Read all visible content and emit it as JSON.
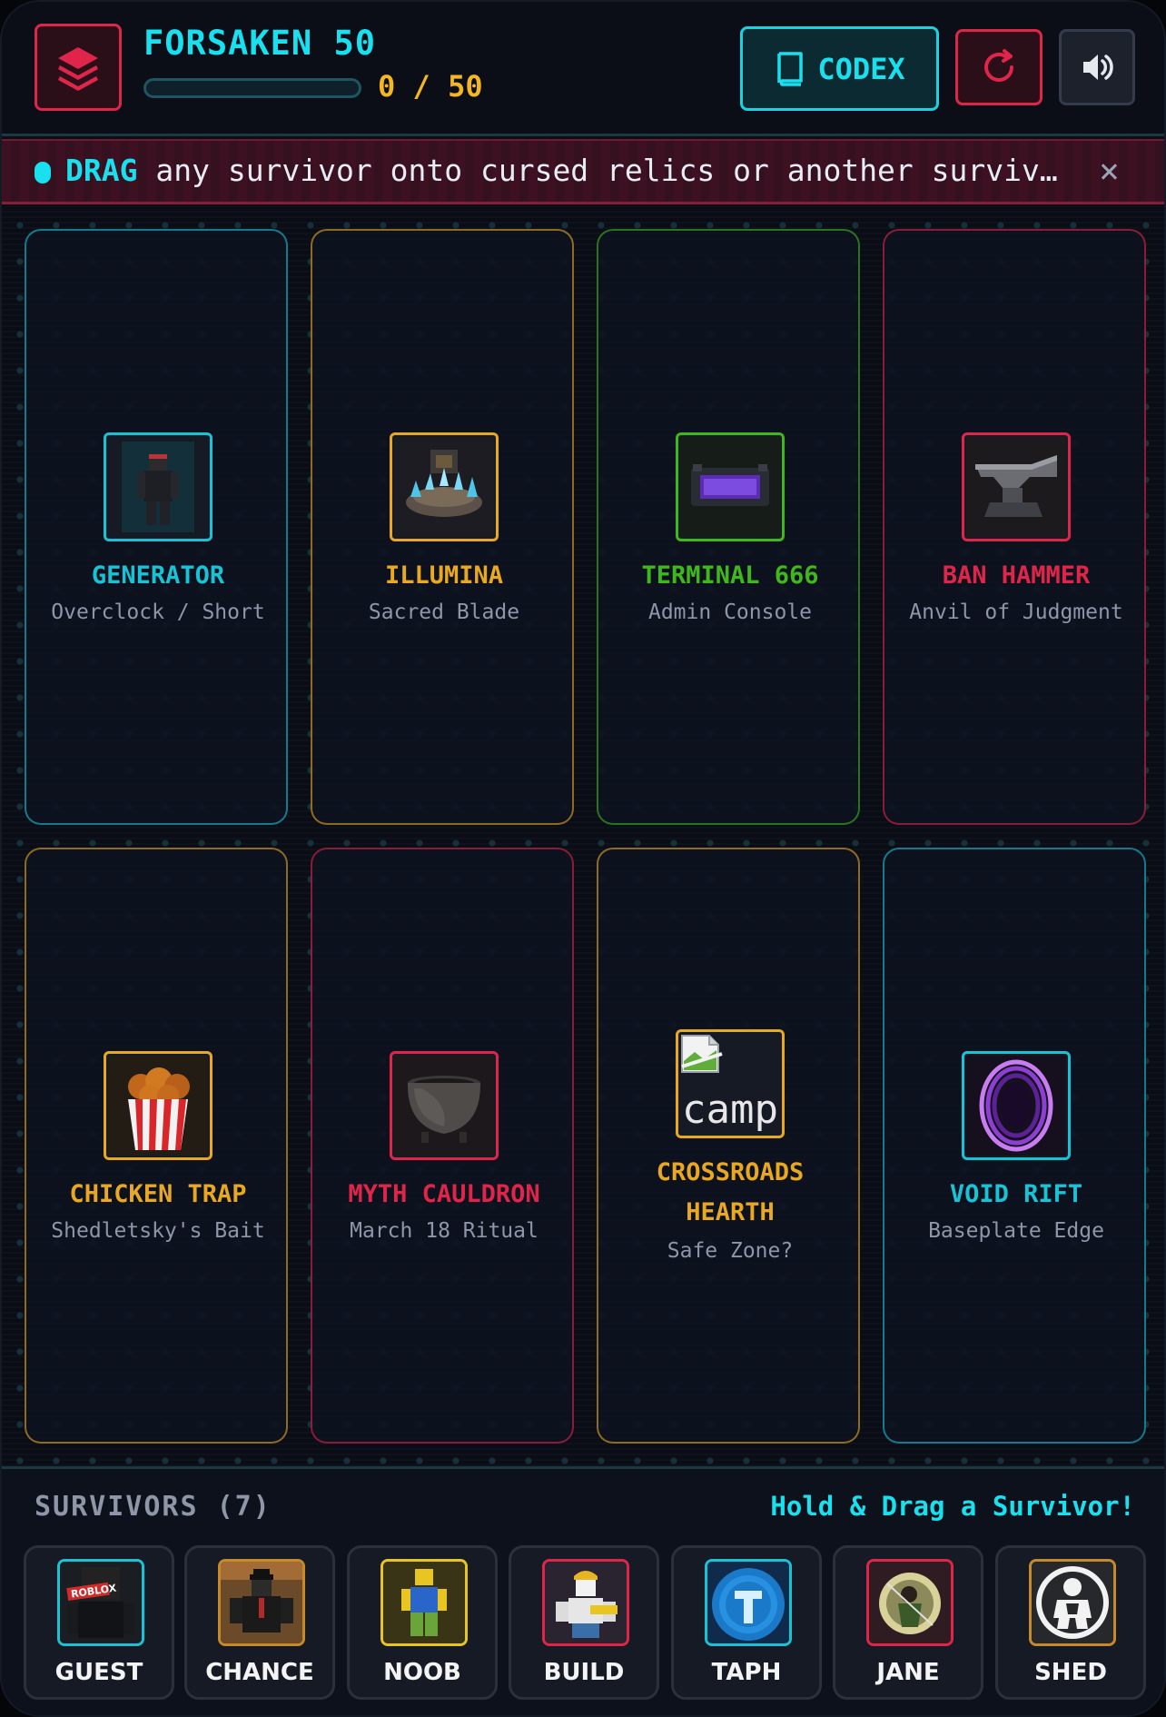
{
  "header": {
    "title": "FORSAKEN 50",
    "progress_text": "0 / 50",
    "progress_fraction": 0,
    "codex_label": "CODEX",
    "icons": {
      "logo": "layers-icon",
      "codex": "book-icon",
      "reset": "reset-icon",
      "sound": "speaker-icon"
    }
  },
  "banner": {
    "strong": "DRAG",
    "text": " any survivor onto cursed relics or another survivor to combine them!",
    "close": "×"
  },
  "relics": [
    {
      "name": "GENERATOR",
      "subtitle": "Overclock / Short",
      "color": "#19c3d6",
      "icon": "generator-figure-icon"
    },
    {
      "name": "ILLUMINA",
      "subtitle": "Sacred Blade",
      "color": "#e8a821",
      "icon": "crystal-altar-icon"
    },
    {
      "name": "TERMINAL 666",
      "subtitle": "Admin Console",
      "color": "#3fb81c",
      "icon": "terminal-icon"
    },
    {
      "name": "BAN HAMMER",
      "subtitle": "Anvil of Judgment",
      "color": "#e0254a",
      "icon": "anvil-icon"
    },
    {
      "name": "CHICKEN TRAP",
      "subtitle": "Shedletsky's Bait",
      "color": "#e8a821",
      "icon": "fried-chicken-bucket-icon"
    },
    {
      "name": "MYTH CAULDRON",
      "subtitle": "March 18 Ritual",
      "color": "#e0254a",
      "icon": "cauldron-icon"
    },
    {
      "name": "CROSSROADS\nHEARTH",
      "name_line1": "CROSSROADS",
      "name_line2": "HEARTH",
      "subtitle": "Safe Zone?",
      "color": "#e8a821",
      "icon": "broken-image-icon",
      "icon_alt": "camp"
    },
    {
      "name": "VOID RIFT",
      "subtitle": "Baseplate Edge",
      "color": "#19c3d6",
      "icon": "purple-portal-icon"
    }
  ],
  "survivors": {
    "title": "SURVIVORS (7)",
    "hint": "Hold & Drag a Survivor!",
    "items": [
      {
        "name": "GUEST",
        "color": "#19c3d6",
        "icon": "guest-avatar-icon"
      },
      {
        "name": "CHANCE",
        "color": "#c78a2a",
        "icon": "chance-avatar-icon"
      },
      {
        "name": "NOOB",
        "color": "#e8c521",
        "icon": "noob-avatar-icon"
      },
      {
        "name": "BUILD",
        "color": "#e0254a",
        "icon": "builderman-avatar-icon"
      },
      {
        "name": "TAPH",
        "color": "#19c3d6",
        "icon": "taph-coin-icon"
      },
      {
        "name": "JANE",
        "color": "#e0254a",
        "icon": "jane-avatar-icon"
      },
      {
        "name": "SHED",
        "color": "#c78a2a",
        "icon": "shedletsky-avatar-icon"
      }
    ]
  }
}
